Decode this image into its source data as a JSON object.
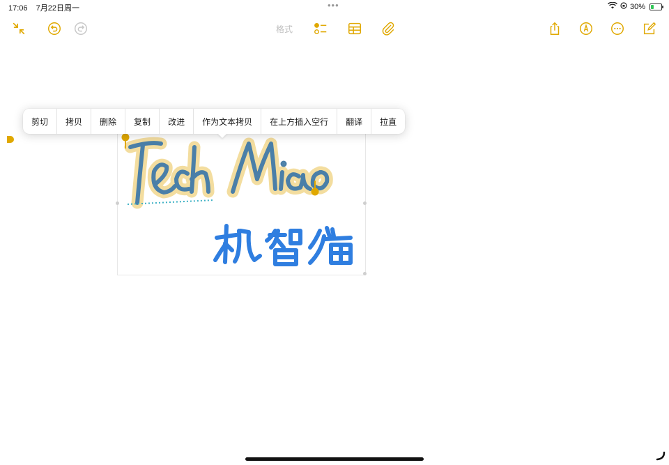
{
  "status_bar": {
    "time": "17:06",
    "date": "7月22日周一",
    "center_dots": "•••",
    "battery_text": "30%",
    "battery_level": 0.3
  },
  "toolbar": {
    "format_label": "格式",
    "icons": {
      "collapse": "collapse-arrows-icon",
      "undo": "undo-icon",
      "redo": "redo-icon",
      "checklist": "checklist-icon",
      "table": "table-icon",
      "attachment": "paperclip-icon",
      "share": "share-icon",
      "markup": "markup-pen-icon",
      "more": "more-ellipsis-icon",
      "compose": "compose-icon"
    },
    "accent_color": "#e0a800"
  },
  "context_menu": {
    "items": [
      "剪切",
      "拷贝",
      "删除",
      "复制",
      "改进",
      "作为文本拷贝",
      "在上方插入空行",
      "翻译",
      "拉直"
    ]
  },
  "drawing": {
    "english_text": "Tech Miao",
    "chinese_text": "机智猫",
    "english_color": "#4a7fa8",
    "highlight_color": "#f3dc9a",
    "chinese_color": "#2f7ee0",
    "handle_color": "#e0a800"
  }
}
